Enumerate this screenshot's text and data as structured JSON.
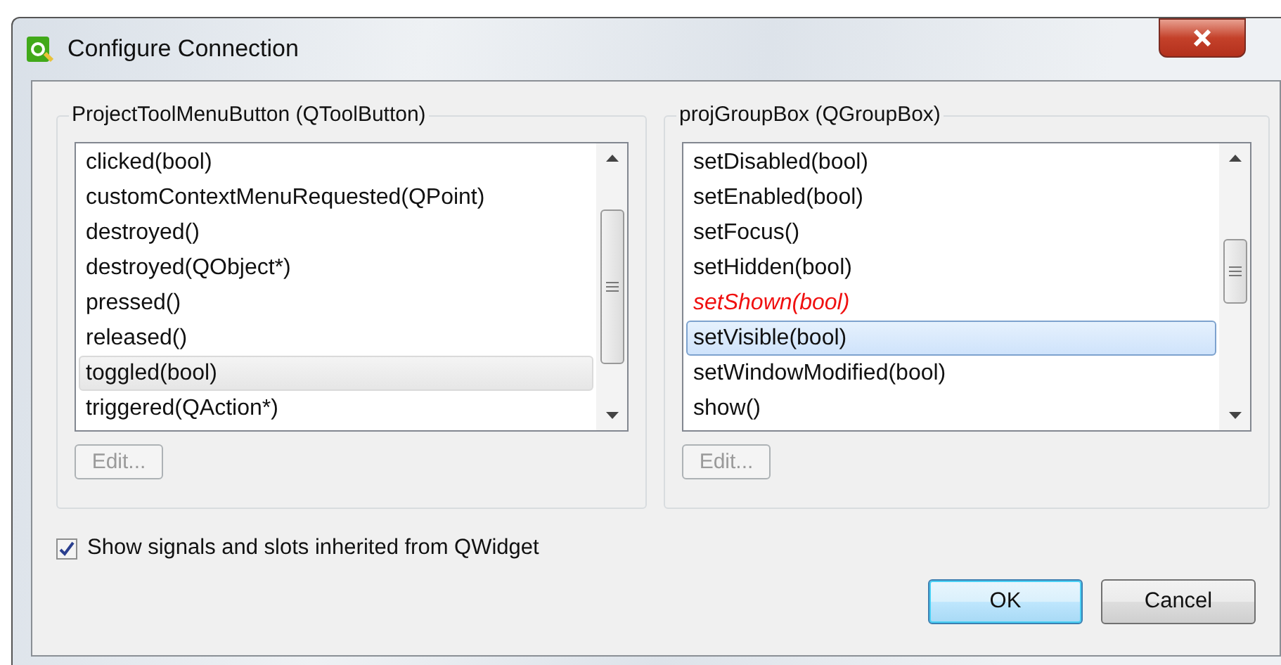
{
  "window": {
    "title": "Configure Connection"
  },
  "groups": [
    {
      "title": "ProjectToolMenuButton (QToolButton)",
      "focused": false,
      "edit_button": {
        "label": "Edit...",
        "disabled": true
      },
      "items": [
        {
          "label": "clicked(bool)",
          "kind": "normal",
          "selected": false
        },
        {
          "label": "customContextMenuRequested(QPoint)",
          "kind": "normal",
          "selected": false
        },
        {
          "label": "destroyed()",
          "kind": "normal",
          "selected": false
        },
        {
          "label": "destroyed(QObject*)",
          "kind": "normal",
          "selected": false
        },
        {
          "label": "pressed()",
          "kind": "normal",
          "selected": false
        },
        {
          "label": "released()",
          "kind": "normal",
          "selected": false
        },
        {
          "label": "toggled(bool)",
          "kind": "normal",
          "selected": true
        },
        {
          "label": "triggered(QAction*)",
          "kind": "normal",
          "selected": false
        }
      ]
    },
    {
      "title": "projGroupBox (QGroupBox)",
      "focused": true,
      "edit_button": {
        "label": "Edit...",
        "disabled": true
      },
      "items": [
        {
          "label": "setDisabled(bool)",
          "kind": "normal",
          "selected": false
        },
        {
          "label": "setEnabled(bool)",
          "kind": "normal",
          "selected": false
        },
        {
          "label": "setFocus()",
          "kind": "normal",
          "selected": false
        },
        {
          "label": "setHidden(bool)",
          "kind": "normal",
          "selected": false
        },
        {
          "label": "setShown(bool)",
          "kind": "invalid",
          "selected": false
        },
        {
          "label": "setVisible(bool)",
          "kind": "normal",
          "selected": true
        },
        {
          "label": "setWindowModified(bool)",
          "kind": "normal",
          "selected": false
        },
        {
          "label": "show()",
          "kind": "normal",
          "selected": false
        }
      ]
    }
  ],
  "inherit_checkbox": {
    "label": "Show signals and slots inherited from QWidget",
    "checked": true
  },
  "buttons": [
    {
      "label": "OK",
      "default": true
    },
    {
      "label": "Cancel",
      "default": false
    }
  ]
}
